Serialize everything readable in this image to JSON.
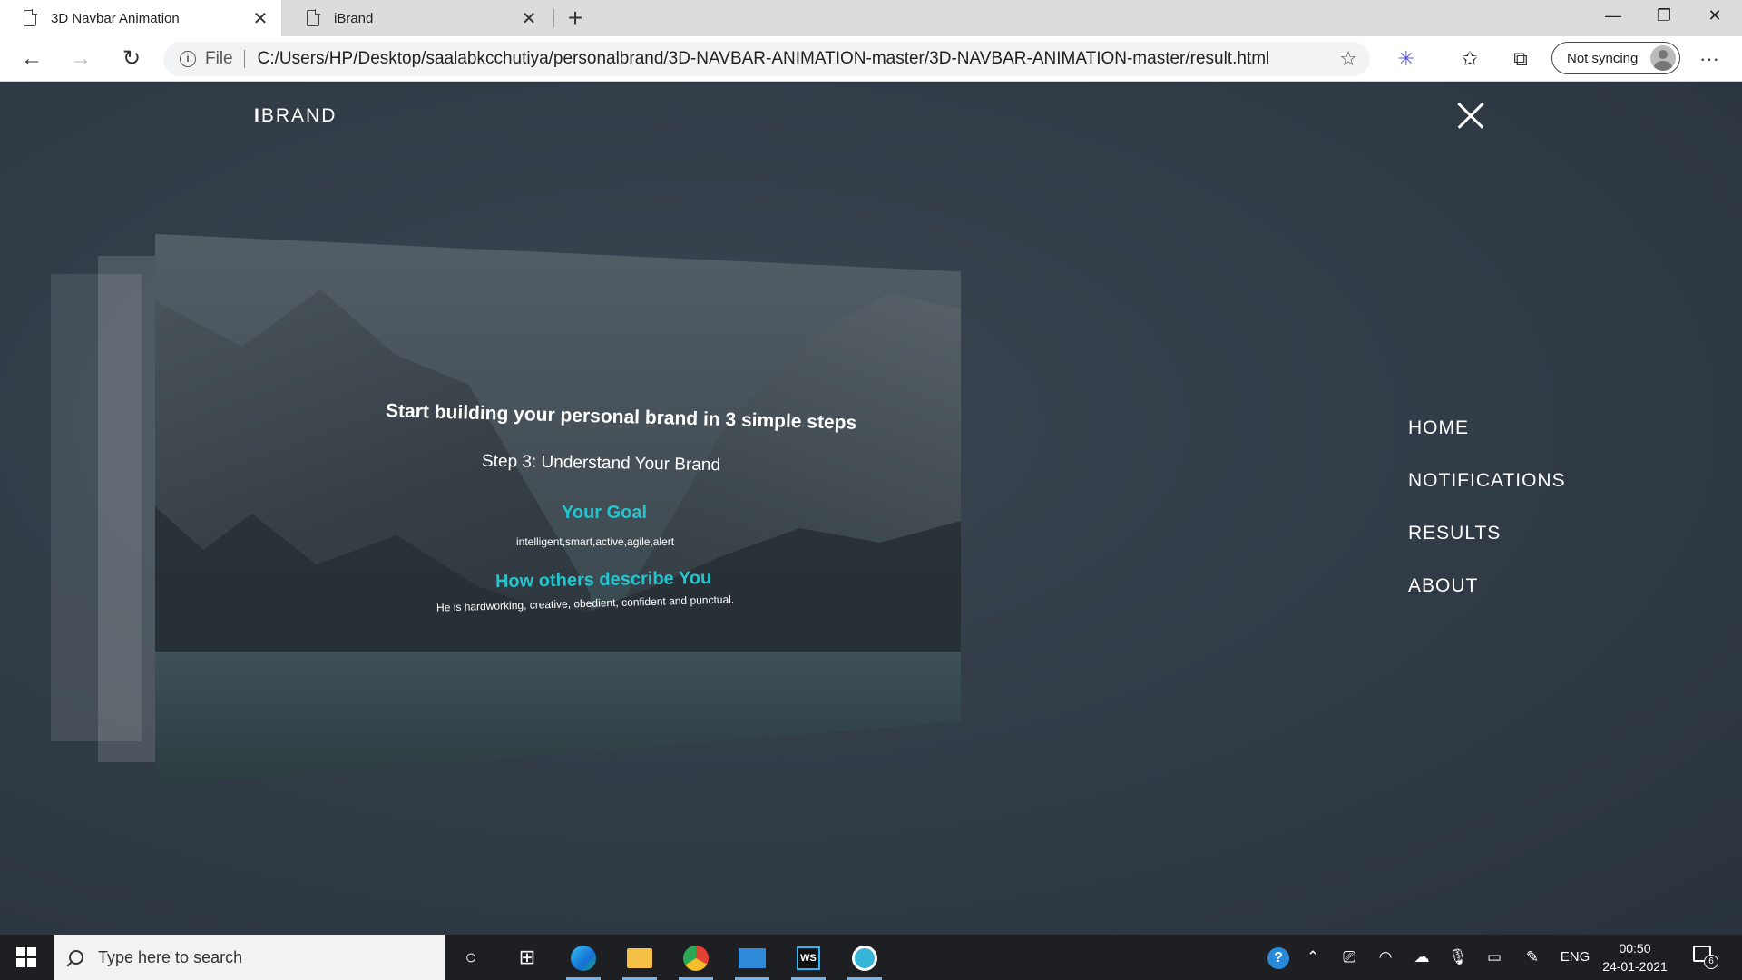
{
  "browser": {
    "tabs": [
      {
        "title": "3D Navbar Animation",
        "close": "✕"
      },
      {
        "title": "iBrand",
        "close": "✕"
      }
    ],
    "new_tab": "+",
    "window_controls": {
      "minimize": "—",
      "maximize": "❐",
      "close": "✕"
    },
    "nav": {
      "back": "←",
      "forward": "→",
      "reload": "↻"
    },
    "address": {
      "scheme_label": "File",
      "url": "C:/Users/HP/Desktop/saalabkcchutiya/personalbrand/3D-NAVBAR-ANIMATION-master/3D-NAVBAR-ANIMATION-master/result.html"
    },
    "toolbar_icons": [
      "favorites-add-icon",
      "extension-icon",
      "favorites-icon",
      "collections-icon",
      "more-icon"
    ],
    "sync_label": "Not syncing",
    "more": "···"
  },
  "page": {
    "brand_prefix": "I",
    "brand_rest": "BRAND",
    "nav_links": [
      "HOME",
      "NOTIFICATIONS",
      "RESULTS",
      "ABOUT"
    ],
    "card": {
      "heading": "Start building your personal brand in 3 simple steps",
      "step": "Step 3: Understand Your Brand",
      "goal_title": "Your Goal",
      "goal_text": "intelligent,smart,active,agile,alert",
      "describe_title": "How others describe You",
      "describe_text": "He is hardworking, creative, obedient, confident and punctual."
    },
    "accent_color": "#22c6d0"
  },
  "taskbar": {
    "search_placeholder": "Type here to search",
    "language": "ENG",
    "time": "00:50",
    "date": "24-01-2021",
    "notification_count": "6"
  }
}
